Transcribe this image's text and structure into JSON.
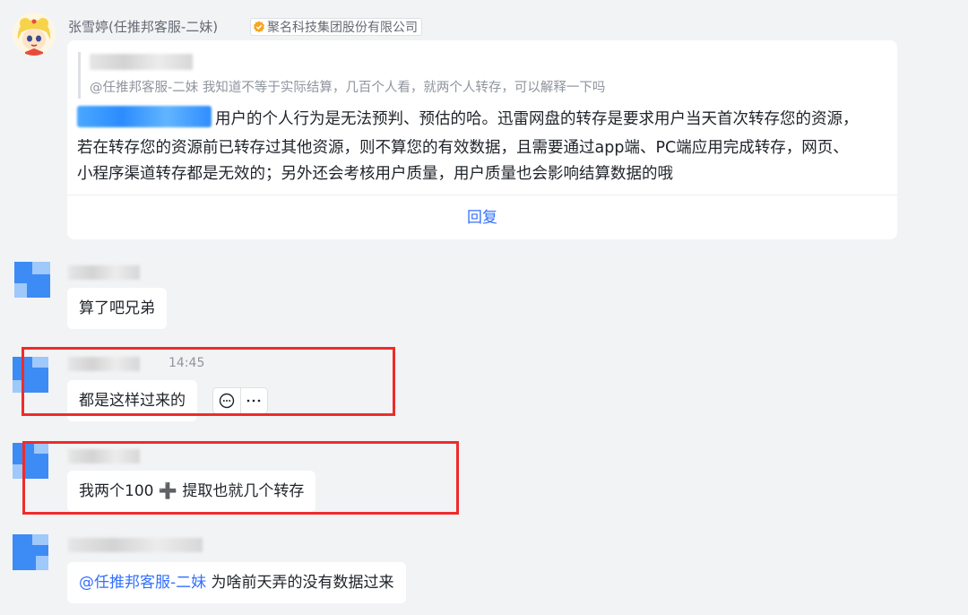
{
  "message1": {
    "sender": "张雪婷(任推邦客服-二妹)",
    "company": "聚名科技集团股份有限公司",
    "quote_text": "@任推邦客服-二妹 我知道不等于实际结算，几百个人看，就两个人转存，可以解释一下吗",
    "body_lines": [
      "用户的个人行为是无法预判、预估的哈。迅雷网盘的转存是要求用户当天首次转存您的资源，",
      "若在转存您的资源前已转存过其他资源，则不算您的有效数据，且需要通过app端、PC端应用完成转存，网页、",
      "小程序渠道转存都是无效的；另外还会考核用户质量，用户质量也会影响结算数据的哦"
    ],
    "reply_label": "回复"
  },
  "message2": {
    "text": "算了吧兄弟"
  },
  "message3": {
    "time": "14:45",
    "text": "都是这样过来的"
  },
  "message4": {
    "text": "我两个100 ➕ 提取也就几个转存"
  },
  "message5": {
    "mention": "@任推邦客服-二妹",
    "text": " 为啥前天弄的没有数据过来"
  },
  "colors": {
    "accent": "#3370ff",
    "highlight_box": "#ef2b2b",
    "background": "#f2f3f5"
  }
}
